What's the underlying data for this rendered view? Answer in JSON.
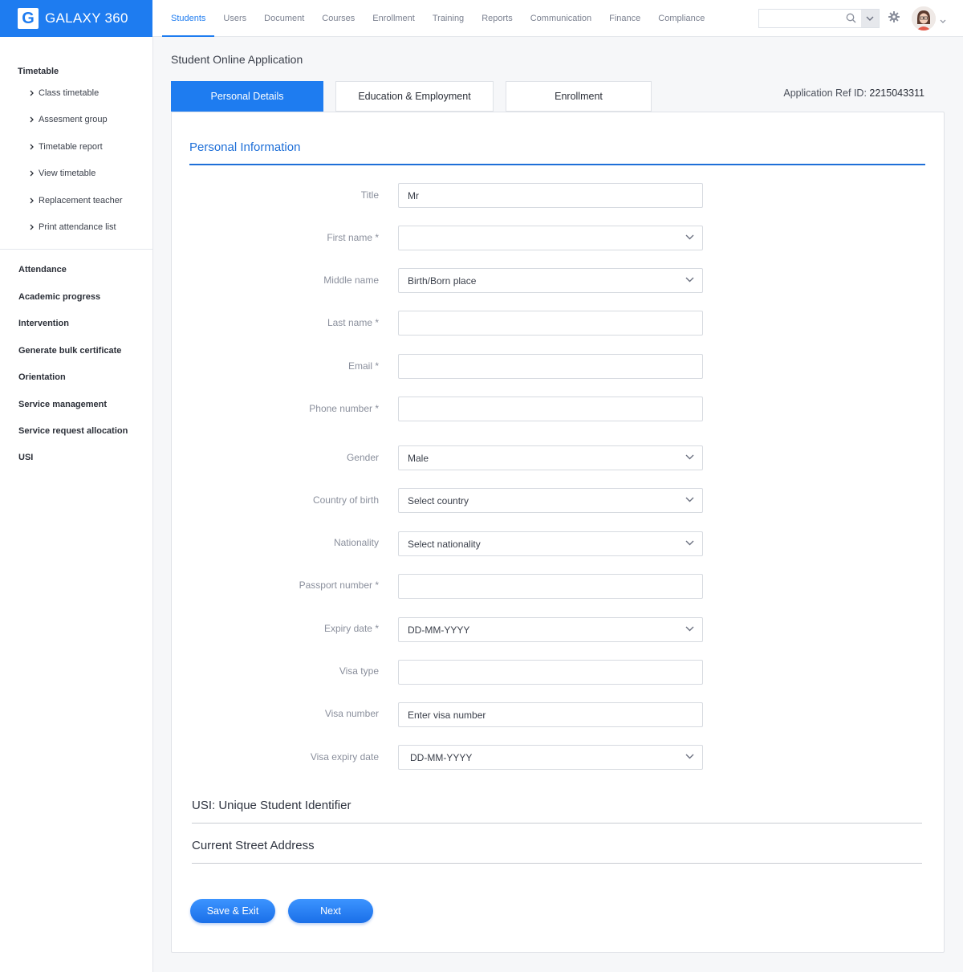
{
  "app": {
    "logo_letter": "G",
    "name": "GALAXY 360",
    "brand_color": "#1e7cf0"
  },
  "topnav": [
    {
      "label": "Students",
      "active": true
    },
    {
      "label": "Users"
    },
    {
      "label": "Document"
    },
    {
      "label": "Courses"
    },
    {
      "label": "Enrollment"
    },
    {
      "label": "Training"
    },
    {
      "label": "Reports"
    },
    {
      "label": "Communication"
    },
    {
      "label": "Finance"
    },
    {
      "label": "Compliance"
    }
  ],
  "search": {
    "value": "",
    "icon": "search-icon"
  },
  "sidebar": {
    "group_title": "Timetable",
    "sub_items": [
      "Class timetable",
      "Assesment group",
      "Timetable report",
      "View timetable",
      "Replacement teacher",
      "Print attendance list"
    ],
    "items": [
      "Attendance",
      "Academic progress",
      "Intervention",
      "Generate bulk certificate",
      "Orientation",
      "Service management",
      "Service request allocation",
      "USI"
    ]
  },
  "page": {
    "title": "Student Online Application",
    "tabs": [
      "Personal Details",
      "Education & Employment",
      "Enrollment"
    ],
    "active_tab": 0,
    "ref_label": "Application Ref ID:",
    "ref_value": "2215043311"
  },
  "form": {
    "section_title": "Personal Information",
    "fields": [
      {
        "label": "Title",
        "value": "Mr",
        "type": "input"
      },
      {
        "label": "First name *",
        "value": "",
        "type": "select"
      },
      {
        "label": "Middle name",
        "value": "Birth/Born place",
        "type": "select"
      },
      {
        "label": "Last name *",
        "value": "",
        "type": "input"
      },
      {
        "label": "Email *",
        "value": "",
        "type": "input"
      },
      {
        "label": "Phone number *",
        "value": "",
        "type": "input"
      },
      {
        "label": "Gender",
        "value": "Male",
        "type": "select"
      },
      {
        "label": "Country of birth",
        "value": "Select country",
        "type": "select"
      },
      {
        "label": "Nationality",
        "value": "Select nationality",
        "type": "select"
      },
      {
        "label": "Passport number *",
        "value": "",
        "type": "input"
      },
      {
        "label": "Expiry date *",
        "value": "DD-MM-YYYY",
        "type": "select"
      },
      {
        "label": "Visa type",
        "value": "",
        "type": "input"
      },
      {
        "label": "Visa number",
        "value": "Enter visa number",
        "type": "input"
      },
      {
        "label": "Visa expiry date",
        "value": "DD-MM-YYYY",
        "type": "select"
      }
    ],
    "collapsed_sections": [
      "USI: Unique Student Identifier",
      "Current Street Address"
    ],
    "buttons": {
      "save_exit": "Save & Exit",
      "next": "Next"
    }
  }
}
